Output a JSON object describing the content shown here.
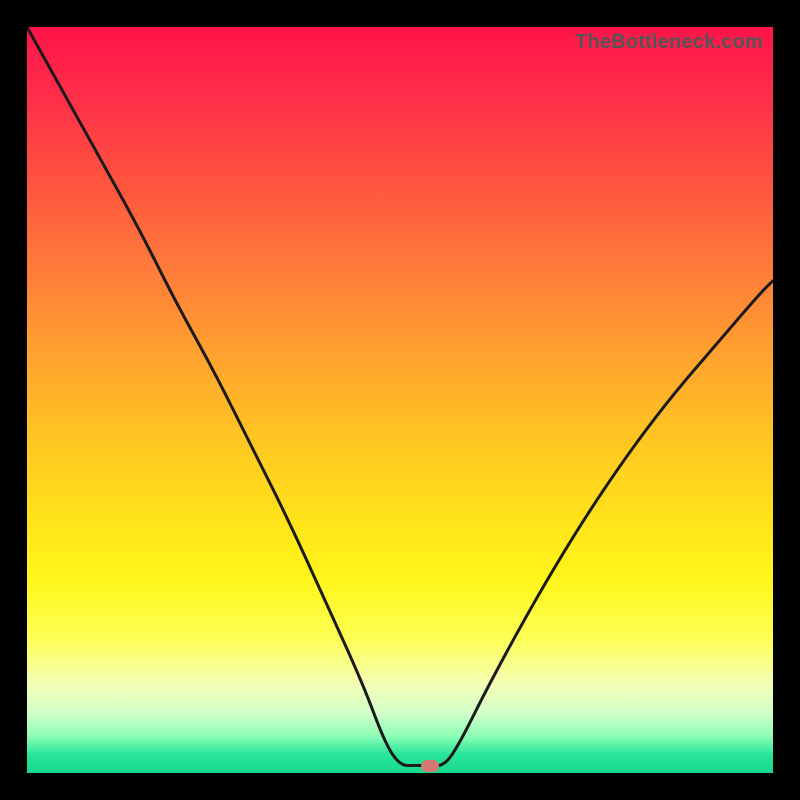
{
  "watermark": "TheBottleneck.com",
  "colors": {
    "frame": "#000000",
    "gradient_stops": [
      "#ff1449",
      "#ff2a4a",
      "#ff5140",
      "#ff7a3a",
      "#ffa22f",
      "#ffc522",
      "#ffe31a",
      "#fff61a",
      "#fdff55",
      "#f4ffb4",
      "#d2ffca",
      "#8effb6",
      "#17d98f"
    ],
    "curve": "#1b1b1b",
    "marker": "#d47a72"
  },
  "chart_data": {
    "type": "line",
    "title": "",
    "xlabel": "",
    "ylabel": "",
    "xlim": [
      0,
      100
    ],
    "ylim": [
      0,
      100
    ],
    "grid": false,
    "legend": false,
    "annotations": [],
    "series": [
      {
        "name": "bottleneck-curve",
        "x": [
          0,
          5,
          10,
          15,
          20,
          25,
          30,
          35,
          40,
          45,
          48,
          50,
          52,
          54,
          56,
          58,
          62,
          68,
          74,
          80,
          86,
          92,
          98,
          100
        ],
        "values": [
          100,
          91,
          82,
          73,
          63,
          54,
          44,
          34,
          23,
          12,
          4,
          1,
          1,
          1,
          1,
          4,
          12,
          23,
          33,
          42,
          50,
          57,
          64,
          66
        ]
      }
    ],
    "marker": {
      "x": 54,
      "y": 1
    }
  }
}
